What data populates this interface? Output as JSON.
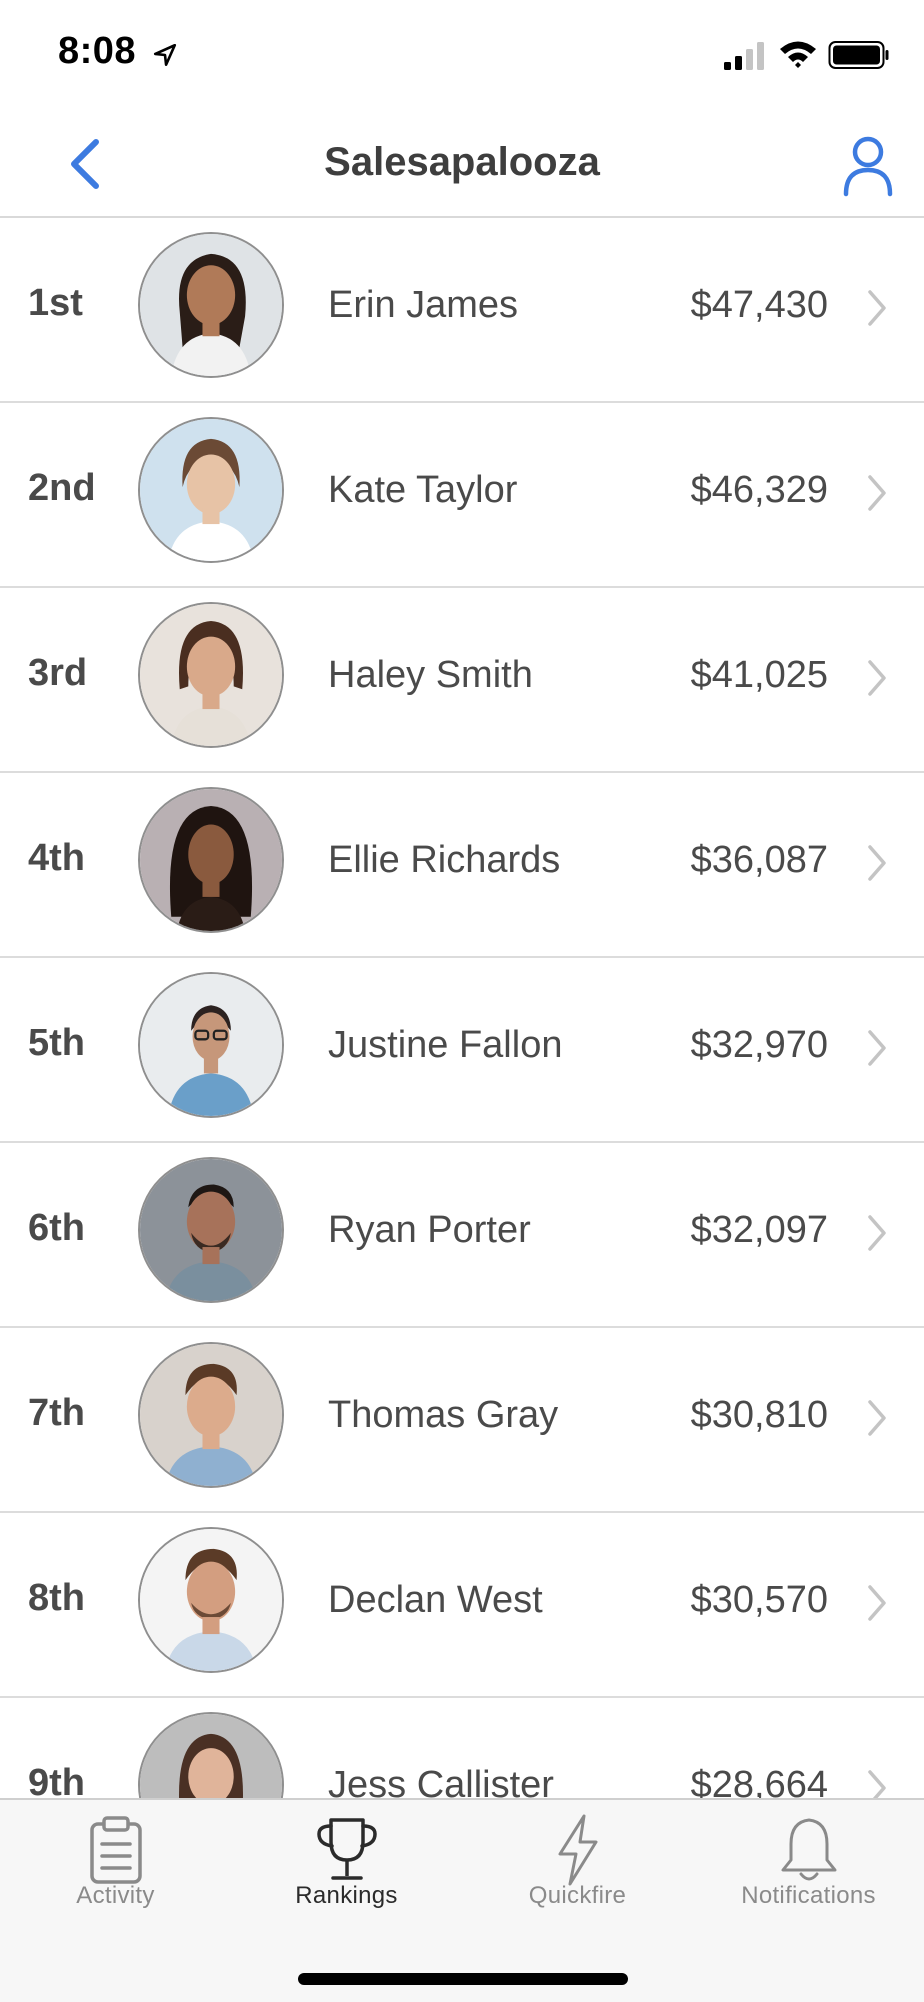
{
  "status_bar": {
    "time": "8:08"
  },
  "nav": {
    "title": "Salesapalooza",
    "back_icon": "chevron-left-icon",
    "profile_icon": "person-icon",
    "accent_color": "#3d7be0"
  },
  "rankings": [
    {
      "position": "1st",
      "name": "Erin James",
      "amount": "$47,430"
    },
    {
      "position": "2nd",
      "name": "Kate Taylor",
      "amount": "$46,329"
    },
    {
      "position": "3rd",
      "name": "Haley Smith",
      "amount": "$41,025"
    },
    {
      "position": "4th",
      "name": "Ellie Richards",
      "amount": "$36,087"
    },
    {
      "position": "5th",
      "name": "Justine Fallon",
      "amount": "$32,970"
    },
    {
      "position": "6th",
      "name": "Ryan Porter",
      "amount": "$32,097"
    },
    {
      "position": "7th",
      "name": "Thomas Gray",
      "amount": "$30,810"
    },
    {
      "position": "8th",
      "name": "Declan West",
      "amount": "$30,570"
    },
    {
      "position": "9th",
      "name": "Jess Callister",
      "amount": "$28,664"
    }
  ],
  "tabs": [
    {
      "label": "Activity",
      "icon": "clipboard-icon",
      "active": false
    },
    {
      "label": "Rankings",
      "icon": "trophy-icon",
      "active": true
    },
    {
      "label": "Quickfire",
      "icon": "lightning-icon",
      "active": false
    },
    {
      "label": "Notifications",
      "icon": "bell-icon",
      "active": false
    }
  ]
}
